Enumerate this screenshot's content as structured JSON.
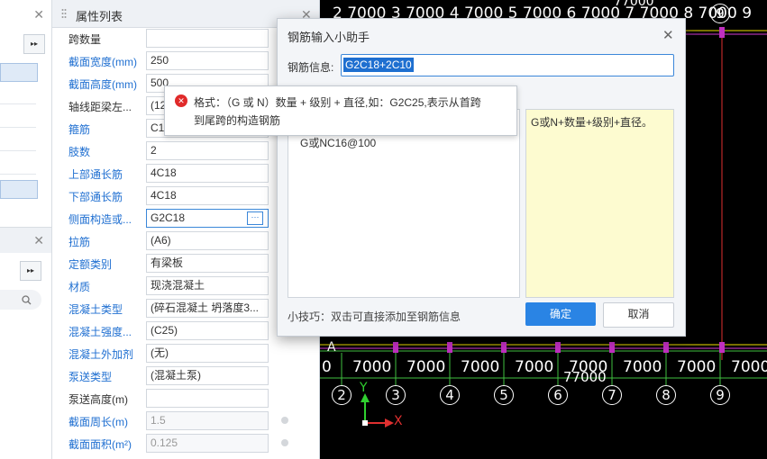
{
  "left_panel": {
    "close_symbol": "✕",
    "close_symbol_2": "✕",
    "more_symbol": "▸▸",
    "more_symbol_2": "▸▸"
  },
  "property_panel": {
    "title": "属性列表",
    "close_symbol": "✕",
    "rows": [
      {
        "name": "跨数量",
        "value": "",
        "blue": false
      },
      {
        "name": "截面宽度(mm)",
        "value": "250",
        "blue": true
      },
      {
        "name": "截面高度(mm)",
        "value": "500",
        "blue": true
      },
      {
        "name": "轴线距梁左...",
        "value": "(12",
        "blue": false
      },
      {
        "name": "箍筋",
        "value": "C1",
        "blue": true
      },
      {
        "name": "肢数",
        "value": "2",
        "blue": true
      },
      {
        "name": "上部通长筋",
        "value": "4C18",
        "blue": true
      },
      {
        "name": "下部通长筋",
        "value": "4C18",
        "blue": true
      },
      {
        "name": "侧面构造或...",
        "value": "G2C18",
        "blue": true
      },
      {
        "name": "拉筋",
        "value": "(A6)",
        "blue": true
      },
      {
        "name": "定额类别",
        "value": "有梁板",
        "blue": true
      },
      {
        "name": "材质",
        "value": "现浇混凝土",
        "blue": true
      },
      {
        "name": "混凝土类型",
        "value": "(碎石混凝土 坍落度3...",
        "blue": true
      },
      {
        "name": "混凝土强度...",
        "value": "(C25)",
        "blue": true
      },
      {
        "name": "混凝土外加剂",
        "value": "(无)",
        "blue": true
      },
      {
        "name": "泵送类型",
        "value": "(混凝土泵)",
        "blue": true
      },
      {
        "name": "泵送高度(m)",
        "value": "",
        "blue": false
      },
      {
        "name": "截面周长(m)",
        "value": "1.5",
        "blue": true
      },
      {
        "name": "截面面积(m²)",
        "value": "0.125",
        "blue": true
      }
    ],
    "ellipsis_symbol": "···"
  },
  "cad": {
    "top_dims": "2 7000 3 7000 4 7000 5 7000 6 7000 7 7000 8 7000 9",
    "top_total": "77000",
    "bottom_dims": [
      "0",
      "7000",
      "7000",
      "7000",
      "7000",
      "7000",
      "7000",
      "7000",
      "7000"
    ],
    "bottom_total": "77000",
    "axis_labels": [
      "2",
      "3",
      "4",
      "5",
      "6",
      "7",
      "8",
      "9"
    ],
    "top_circle": "9",
    "row_label": "A",
    "y_axis": "Y",
    "x_axis": "X"
  },
  "dialog": {
    "title": "钢筋输入小助手",
    "close_symbol": "✕",
    "label": "钢筋信息:",
    "input_value": "G2C18+2C10",
    "list_text": "G或NC16@100",
    "hint_text": "G或N+数量+级别+直径。",
    "tip": "小技巧：双击可直接添加至钢筋信息",
    "ok_label": "确定",
    "cancel_label": "取消"
  },
  "tooltip": {
    "error_icon": "✕",
    "line1": "格式：（G 或 N）数量 + 级别 + 直径,如：G2C25,表示从首跨",
    "line2": "到尾跨的构造钢筋"
  }
}
